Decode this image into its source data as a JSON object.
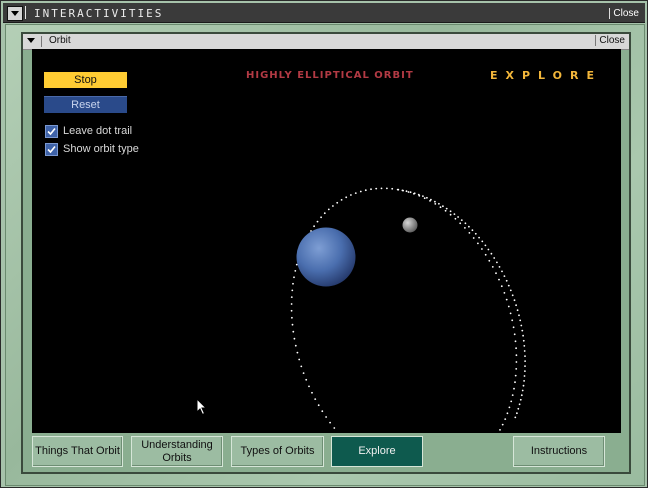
{
  "outer_window": {
    "title": "INTERACTIVITIES",
    "close_label": "Close"
  },
  "inner_window": {
    "title": "Orbit",
    "close_label": "Close"
  },
  "stage": {
    "heading": "HIGHLY ELLIPTICAL ORBIT",
    "mode_label": "EXPLORE",
    "stop_label": "Stop",
    "reset_label": "Reset",
    "checkboxes": [
      {
        "label": "Leave dot trail",
        "checked": true
      },
      {
        "label": "Show orbit type",
        "checked": true
      }
    ]
  },
  "nav": {
    "things_that_orbit": "Things That Orbit",
    "understanding_line1": "Understanding",
    "understanding_line2": "Orbits",
    "types_of_orbits": "Types of Orbits",
    "explore": "Explore",
    "instructions": "Instructions"
  },
  "colors": {
    "stage_bg": "#000000",
    "stop_button": "#ffcc33",
    "reset_button": "#2a4a8a",
    "heading": "#b23a44",
    "explore_heading": "#f2b63a",
    "active_nav": "#0e5a4e",
    "planet": "#4a74b4",
    "moon": "#9a9a9a"
  },
  "icons": [
    "menu-triangle-icon",
    "checkmark-icon",
    "planet-icon",
    "moon-icon",
    "pointer-cursor-icon"
  ]
}
